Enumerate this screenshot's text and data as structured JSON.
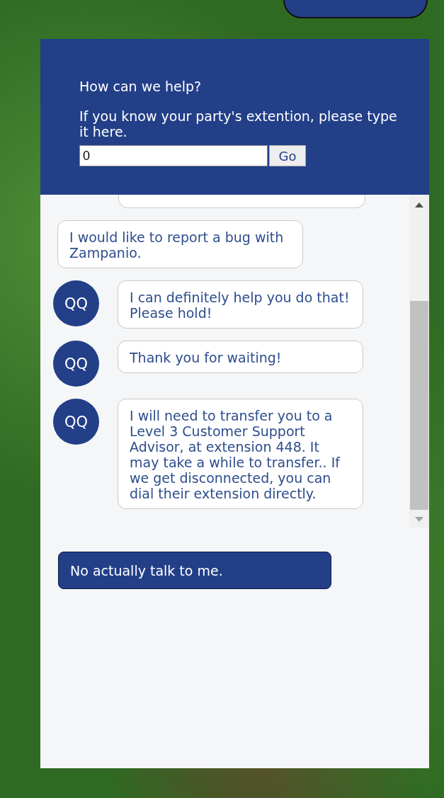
{
  "header": {
    "title": "How can we help?",
    "instructions": "If you know your party's extention, please type it here.",
    "extension_field": {
      "value": "0"
    },
    "go_button": "Go"
  },
  "messages": [
    {
      "kind": "user",
      "text": "I would like to report a bug with Zampanio."
    },
    {
      "kind": "agent",
      "avatar": "QQ",
      "text": "I can definitely help you do that! Please hold!"
    },
    {
      "kind": "agent",
      "avatar": "QQ",
      "text": "Thank you for waiting!"
    },
    {
      "kind": "agent",
      "avatar": "QQ",
      "text": "I will need to transfer you to a Level 3 Customer Support Advisor, at extension 448. It may take a while to transfer.. If we get disconnected, you can dial their extension directly."
    }
  ],
  "reply_options": [
    "No actually talk to me."
  ]
}
